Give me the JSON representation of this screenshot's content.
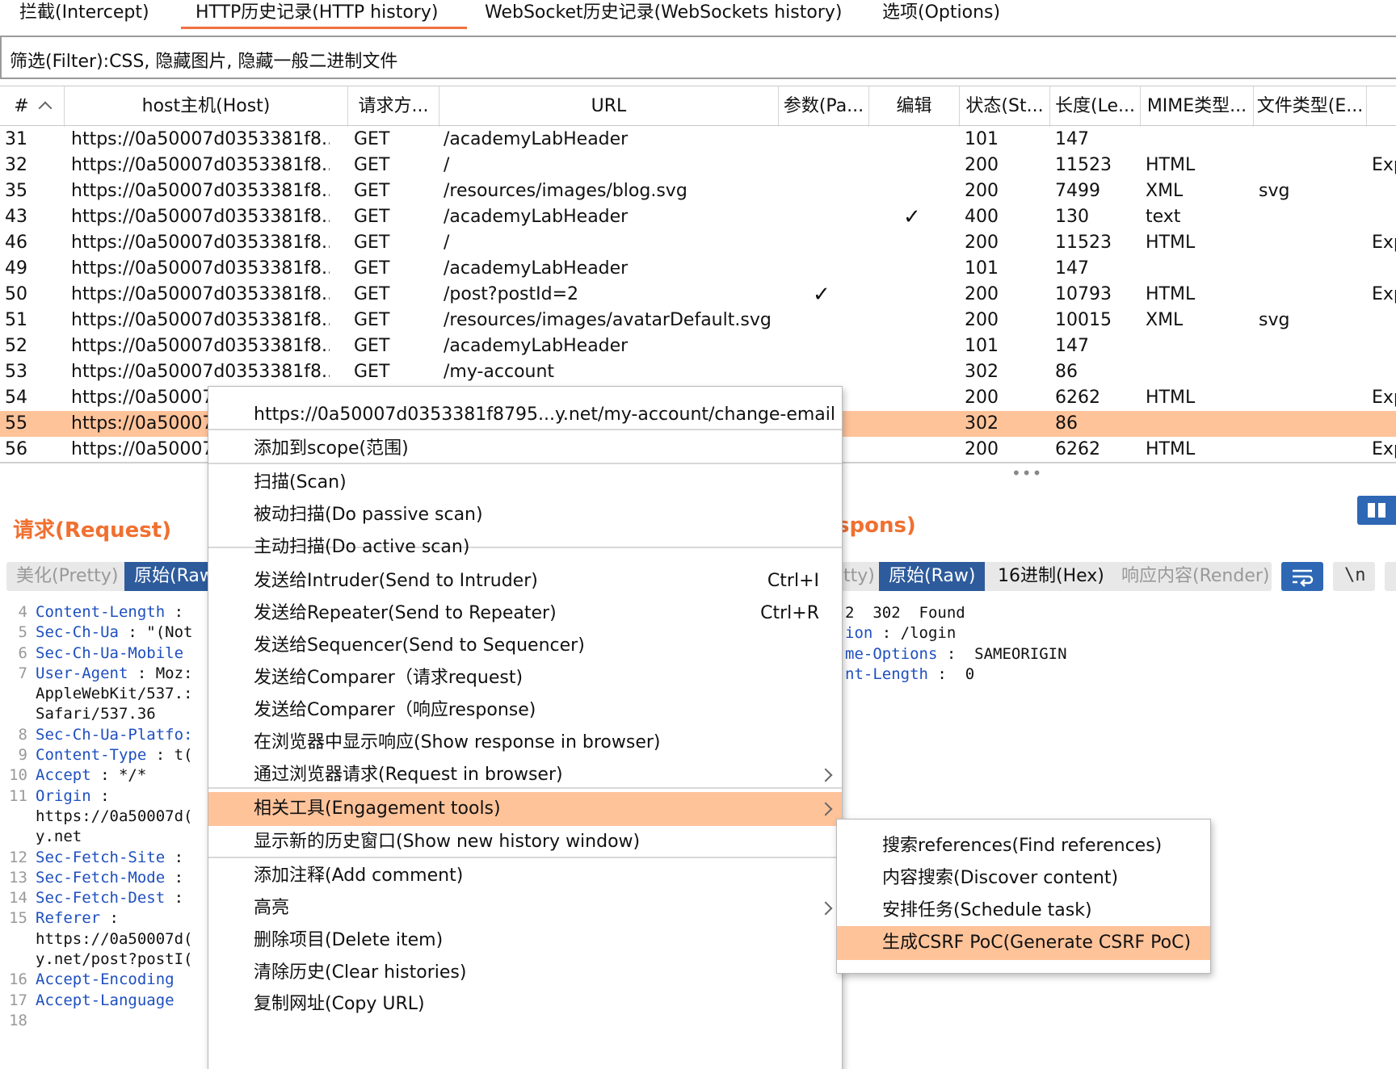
{
  "tabs": [
    {
      "label": "拦截(Intercept)"
    },
    {
      "label": "HTTP历史记录(HTTP history)"
    },
    {
      "label": "WebSocket历史记录(WebSockets history)"
    },
    {
      "label": "选项(Options)"
    }
  ],
  "filter": {
    "text": "筛选(Filter):CSS, 隐藏图片, 隐藏一般二进制文件"
  },
  "table": {
    "headers": [
      "#",
      "host主机(Host)",
      "请求方...",
      "URL",
      "参数(Pa...",
      "编辑",
      "状态(St...",
      "长度(Le...",
      "MIME类型...",
      "文件类型(E..."
    ],
    "rows": [
      {
        "num": "31",
        "host": "https://0a50007d0353381f8...",
        "method": "GET",
        "url": "/academyLabHeader",
        "params": "",
        "edited": "",
        "status": "101",
        "length": "147",
        "mime": "",
        "ext": "",
        "extra": ""
      },
      {
        "num": "32",
        "host": "https://0a50007d0353381f8...",
        "method": "GET",
        "url": "/",
        "params": "",
        "edited": "",
        "status": "200",
        "length": "11523",
        "mime": "HTML",
        "ext": "",
        "extra": "Exp"
      },
      {
        "num": "35",
        "host": "https://0a50007d0353381f8...",
        "method": "GET",
        "url": "/resources/images/blog.svg",
        "params": "",
        "edited": "",
        "status": "200",
        "length": "7499",
        "mime": "XML",
        "ext": "svg",
        "extra": ""
      },
      {
        "num": "43",
        "host": "https://0a50007d0353381f8...",
        "method": "GET",
        "url": "/academyLabHeader",
        "params": "",
        "edited": "✓",
        "status": "400",
        "length": "130",
        "mime": "text",
        "ext": "",
        "extra": ""
      },
      {
        "num": "46",
        "host": "https://0a50007d0353381f8...",
        "method": "GET",
        "url": "/",
        "params": "",
        "edited": "",
        "status": "200",
        "length": "11523",
        "mime": "HTML",
        "ext": "",
        "extra": "Exp"
      },
      {
        "num": "49",
        "host": "https://0a50007d0353381f8...",
        "method": "GET",
        "url": "/academyLabHeader",
        "params": "",
        "edited": "",
        "status": "101",
        "length": "147",
        "mime": "",
        "ext": "",
        "extra": ""
      },
      {
        "num": "50",
        "host": "https://0a50007d0353381f8...",
        "method": "GET",
        "url": "/post?postId=2",
        "params": "✓",
        "edited": "",
        "status": "200",
        "length": "10793",
        "mime": "HTML",
        "ext": "",
        "extra": "Exp"
      },
      {
        "num": "51",
        "host": "https://0a50007d0353381f8...",
        "method": "GET",
        "url": "/resources/images/avatarDefault.svg",
        "params": "",
        "edited": "",
        "status": "200",
        "length": "10015",
        "mime": "XML",
        "ext": "svg",
        "extra": ""
      },
      {
        "num": "52",
        "host": "https://0a50007d0353381f8...",
        "method": "GET",
        "url": "/academyLabHeader",
        "params": "",
        "edited": "",
        "status": "101",
        "length": "147",
        "mime": "",
        "ext": "",
        "extra": ""
      },
      {
        "num": "53",
        "host": "https://0a50007d0353381f8...",
        "method": "GET",
        "url": "/my-account",
        "params": "",
        "edited": "",
        "status": "302",
        "length": "86",
        "mime": "",
        "ext": "",
        "extra": ""
      },
      {
        "num": "54",
        "host": "https://0a50007",
        "method": "",
        "url": "",
        "params": "",
        "edited": "",
        "status": "200",
        "length": "6262",
        "mime": "HTML",
        "ext": "",
        "extra": "Exp"
      },
      {
        "num": "55",
        "host": "https://0a50007",
        "method": "",
        "url": "",
        "params": "",
        "edited": "",
        "status": "302",
        "length": "86",
        "mime": "",
        "ext": "",
        "extra": ""
      },
      {
        "num": "56",
        "host": "https://0a50007",
        "method": "",
        "url": "",
        "params": "",
        "edited": "",
        "status": "200",
        "length": "6262",
        "mime": "HTML",
        "ext": "",
        "extra": "Exp"
      }
    ]
  },
  "request": {
    "title": "请求(Request)",
    "tabs": [
      "美化(Pretty)",
      "原始(Raw"
    ],
    "lines": [
      {
        "n": "4",
        "key": "Content-Length",
        "rest": " :"
      },
      {
        "n": "5",
        "key": "Sec-Ch-Ua",
        "rest": " : \"(Not"
      },
      {
        "n": "6",
        "key": "Sec-Ch-Ua-Mobile",
        "rest": ""
      },
      {
        "n": "7",
        "key": "User-Agent",
        "rest": " : Moz:"
      },
      {
        "n": "",
        "key": "",
        "rest": "AppleWebKit/537.:"
      },
      {
        "n": "",
        "key": "",
        "rest": "Safari/537.36"
      },
      {
        "n": "8",
        "key": "Sec-Ch-Ua-Platfo:",
        "rest": ""
      },
      {
        "n": "9",
        "key": "Content-Type",
        "rest": " : t("
      },
      {
        "n": "10",
        "key": "Accept",
        "rest": " : */*"
      },
      {
        "n": "11",
        "key": "Origin",
        "rest": " :"
      },
      {
        "n": "",
        "key": "",
        "rest": "https://0a50007d("
      },
      {
        "n": "",
        "key": "",
        "rest": "y.net"
      },
      {
        "n": "12",
        "key": "Sec-Fetch-Site",
        "rest": " :"
      },
      {
        "n": "13",
        "key": "Sec-Fetch-Mode",
        "rest": " :"
      },
      {
        "n": "14",
        "key": "Sec-Fetch-Dest",
        "rest": " :"
      },
      {
        "n": "15",
        "key": "Referer",
        "rest": " :"
      },
      {
        "n": "",
        "key": "",
        "rest": "https://0a50007d("
      },
      {
        "n": "",
        "key": "",
        "rest": "y.net/post?postI("
      },
      {
        "n": "16",
        "key": "Accept-Encoding",
        "rest": ""
      },
      {
        "n": "17",
        "key": "Accept-Language",
        "rest": ""
      },
      {
        "n": "18",
        "key": "",
        "rest": ""
      }
    ]
  },
  "response": {
    "title": "spons)",
    "tabs": [
      "tty)",
      "原始(Raw)",
      "16进制(Hex)",
      "响应内容(Render)"
    ],
    "newline_glyph": "\\n",
    "lines": [
      {
        "key": "",
        "rest": "2  302  Found"
      },
      {
        "key": "ion",
        "rest": " : /login"
      },
      {
        "key": "me-Options",
        "rest": " :  SAMEORIGIN"
      },
      {
        "key": "nt-Length",
        "rest": " :  0"
      }
    ]
  },
  "context_menu": {
    "items": [
      {
        "label": "https://0a50007d0353381f8795...y.net/my-account/change-email",
        "shortcut": "",
        "submenu": false,
        "highlighted": false
      },
      {
        "label": "添加到scope(范围)",
        "shortcut": "",
        "submenu": false,
        "highlighted": false
      },
      {
        "label": "扫描(Scan)",
        "shortcut": "",
        "submenu": false,
        "highlighted": false
      },
      {
        "label": "被动扫描(Do passive scan)",
        "shortcut": "",
        "submenu": false,
        "highlighted": false
      },
      {
        "label": "主动扫描(Do active scan)",
        "shortcut": "",
        "submenu": false,
        "highlighted": false
      },
      {
        "label": "发送给Intruder(Send to Intruder)",
        "shortcut": "Ctrl+I",
        "submenu": false,
        "highlighted": false
      },
      {
        "label": "发送给Repeater(Send to Repeater)",
        "shortcut": "Ctrl+R",
        "submenu": false,
        "highlighted": false
      },
      {
        "label": "发送给Sequencer(Send to Sequencer)",
        "shortcut": "",
        "submenu": false,
        "highlighted": false
      },
      {
        "label": "发送给Comparer（请求request)",
        "shortcut": "",
        "submenu": false,
        "highlighted": false
      },
      {
        "label": "发送给Comparer（响应response)",
        "shortcut": "",
        "submenu": false,
        "highlighted": false
      },
      {
        "label": "在浏览器中显示响应(Show response in browser)",
        "shortcut": "",
        "submenu": false,
        "highlighted": false
      },
      {
        "label": "通过浏览器请求(Request in browser)",
        "shortcut": "",
        "submenu": true,
        "highlighted": false
      },
      {
        "label": "相关工具(Engagement tools)",
        "shortcut": "",
        "submenu": true,
        "highlighted": true
      },
      {
        "label": "显示新的历史窗口(Show new history window)",
        "shortcut": "",
        "submenu": false,
        "highlighted": false
      },
      {
        "label": "添加注释(Add comment)",
        "shortcut": "",
        "submenu": false,
        "highlighted": false
      },
      {
        "label": "高亮",
        "shortcut": "",
        "submenu": true,
        "highlighted": false
      },
      {
        "label": "删除项目(Delete item)",
        "shortcut": "",
        "submenu": false,
        "highlighted": false
      },
      {
        "label": "清除历史(Clear histories)",
        "shortcut": "",
        "submenu": false,
        "highlighted": false
      },
      {
        "label": "复制网址(Copy URL)",
        "shortcut": "",
        "submenu": false,
        "highlighted": false
      }
    ]
  },
  "submenu": {
    "items": [
      {
        "label": "搜索references(Find references)",
        "highlighted": false
      },
      {
        "label": "内容搜索(Discover content)",
        "highlighted": false
      },
      {
        "label": "安排任务(Schedule task)",
        "highlighted": false
      },
      {
        "label": "生成CSRF PoC(Generate CSRF PoC)",
        "highlighted": true
      }
    ]
  },
  "colors": {
    "accent": "#f07030",
    "selection": "#ffc39a",
    "active_tab": "#2e5b9b",
    "key_text": "#1e4fbf"
  }
}
